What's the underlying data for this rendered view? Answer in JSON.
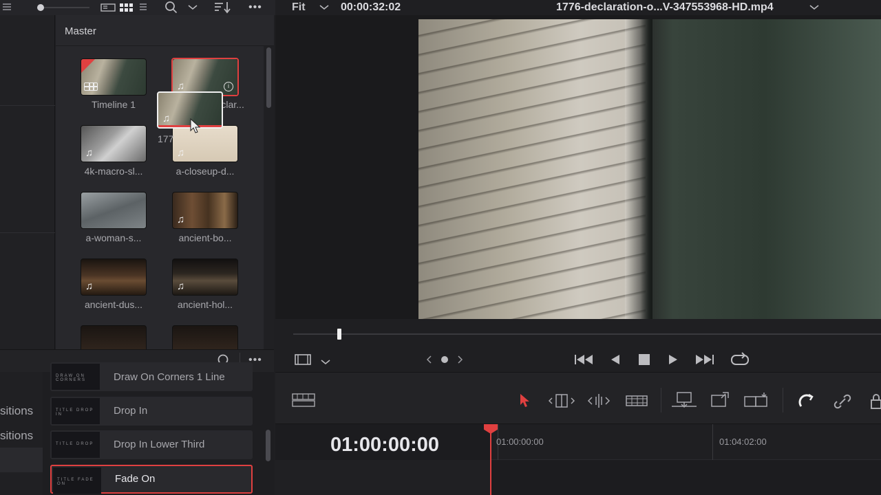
{
  "topbar": {
    "fit_label": "Fit",
    "timecode": "00:00:32:02",
    "filename": "1776-declaration-o...V-347553968-HD.mp4",
    "more_glyph": "•••"
  },
  "pool": {
    "title": "Master",
    "clips": [
      {
        "label": "Timeline 1",
        "kind": "timeline"
      },
      {
        "label": "1776-declar...",
        "kind": "audio"
      },
      {
        "label": "4k-macro-sl...",
        "kind": "audio"
      },
      {
        "label": "a-closeup-d...",
        "kind": "audio"
      },
      {
        "label": "a-woman-s...",
        "kind": "video"
      },
      {
        "label": "ancient-bo...",
        "kind": "audio"
      },
      {
        "label": "ancient-dus...",
        "kind": "audio"
      },
      {
        "label": "ancient-hol...",
        "kind": "audio"
      }
    ],
    "drag_label": "177"
  },
  "effects": {
    "categories": [
      "sitions",
      "sitions"
    ],
    "items": [
      {
        "label": "Draw On Corners 1 Line",
        "thumb_text": "DRAW ON CORNERS"
      },
      {
        "label": "Drop In",
        "thumb_text": "TITLE DROP IN"
      },
      {
        "label": "Drop In Lower Third",
        "thumb_text": "TITLE DROP"
      },
      {
        "label": "Fade On",
        "thumb_text": "TITLE FADE ON"
      }
    ]
  },
  "timeline": {
    "timecode": "01:00:00:00",
    "ruler": [
      "01:00:00:00",
      "01:04:02:00"
    ]
  },
  "colors": {
    "accent_red": "#e04040"
  }
}
